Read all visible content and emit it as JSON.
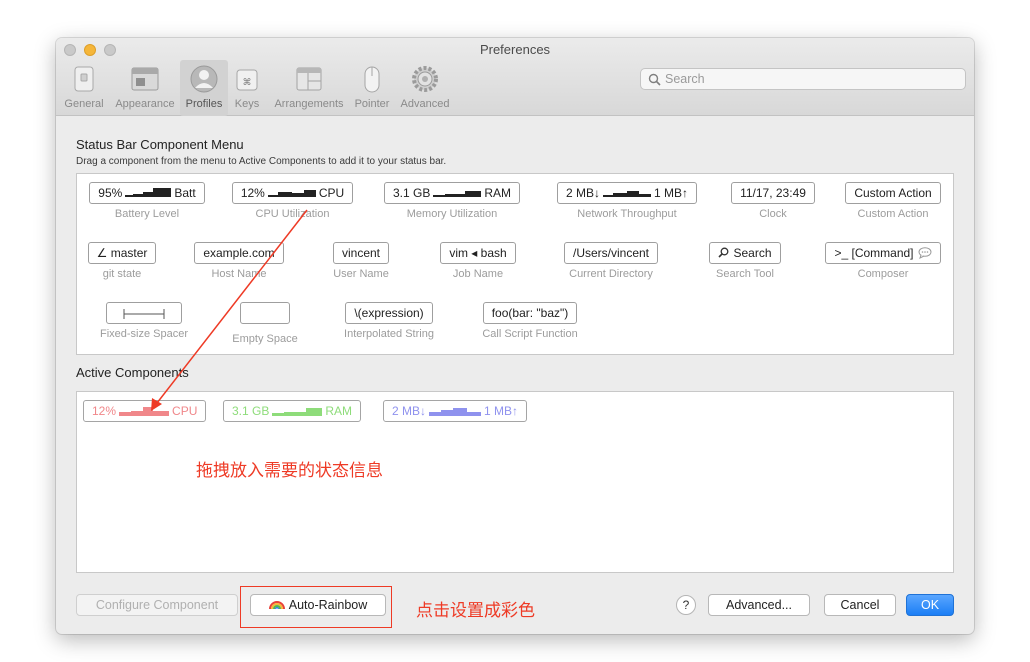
{
  "window": {
    "title": "Preferences"
  },
  "search": {
    "placeholder": "Search",
    "icon": "search-icon"
  },
  "toolbar": {
    "items": [
      {
        "label": "General",
        "icon": "general-icon",
        "selected": false
      },
      {
        "label": "Appearance",
        "icon": "appearance-icon",
        "selected": false
      },
      {
        "label": "Profiles",
        "icon": "profiles-icon",
        "selected": true
      },
      {
        "label": "Keys",
        "icon": "keys-icon",
        "selected": false
      },
      {
        "label": "Arrangements",
        "icon": "arrangements-icon",
        "selected": false
      },
      {
        "label": "Pointer",
        "icon": "pointer-icon",
        "selected": false
      },
      {
        "label": "Advanced",
        "icon": "advanced-icon",
        "selected": false
      }
    ]
  },
  "menu": {
    "title": "Status Bar Component Menu",
    "subtitle": "Drag a component from the menu to Active Components to add it to your status bar.",
    "components": [
      {
        "chip_pre": "95%",
        "chip_post": "Batt",
        "caption": "Battery Level"
      },
      {
        "chip_pre": "12%",
        "chip_post": "CPU",
        "caption": "CPU Utilization"
      },
      {
        "chip_pre": "3.1 GB",
        "chip_post": "RAM",
        "caption": "Memory Utilization"
      },
      {
        "chip_pre": "2 MB↓",
        "chip_post": "1 MB↑",
        "caption": "Network Throughput"
      },
      {
        "chip": "11/17, 23:49",
        "caption": "Clock"
      },
      {
        "chip": "Custom Action",
        "caption": "Custom Action"
      },
      {
        "chip": "∠ master",
        "caption": "git state"
      },
      {
        "chip": "example.com",
        "caption": "Host Name"
      },
      {
        "chip": "vincent",
        "caption": "User Name"
      },
      {
        "chip": "vim ◂ bash",
        "caption": "Job Name"
      },
      {
        "chip": "/Users/vincent",
        "caption": "Current Directory"
      },
      {
        "chip": "Search",
        "caption": "Search Tool",
        "icon": "magnifier-icon"
      },
      {
        "chip": ">_ [Command]",
        "caption": "Composer",
        "icon": "speech-bubble-icon"
      },
      {
        "chip": "",
        "caption": "Fixed-size Spacer",
        "icon": "spacer-icon"
      },
      {
        "chip": "",
        "caption": "Empty Space"
      },
      {
        "chip": "\\(expression)",
        "caption": "Interpolated String"
      },
      {
        "chip": "foo(bar: \"baz\")",
        "caption": "Call Script Function"
      }
    ]
  },
  "active": {
    "title": "Active Components",
    "items": [
      {
        "pre": "12%",
        "post": "CPU",
        "color": "#f0878a"
      },
      {
        "pre": "3.1 GB",
        "post": "RAM",
        "color": "#8edc7a"
      },
      {
        "pre": "2 MB↓",
        "post": "1 MB↑",
        "color": "#8f92ee"
      }
    ]
  },
  "buttons": {
    "configure": "Configure Component",
    "auto_rainbow": "Auto-Rainbow",
    "auto_rainbow_icon": "rainbow-icon",
    "help": "?",
    "advanced": "Advanced...",
    "cancel": "Cancel",
    "ok": "OK"
  },
  "annotations": {
    "drag_hint": "拖拽放入需要的状态信息",
    "rainbow_hint": "点击设置成彩色",
    "color": "#ee3a25"
  },
  "colors": {
    "accent": "#1b7ef5"
  }
}
